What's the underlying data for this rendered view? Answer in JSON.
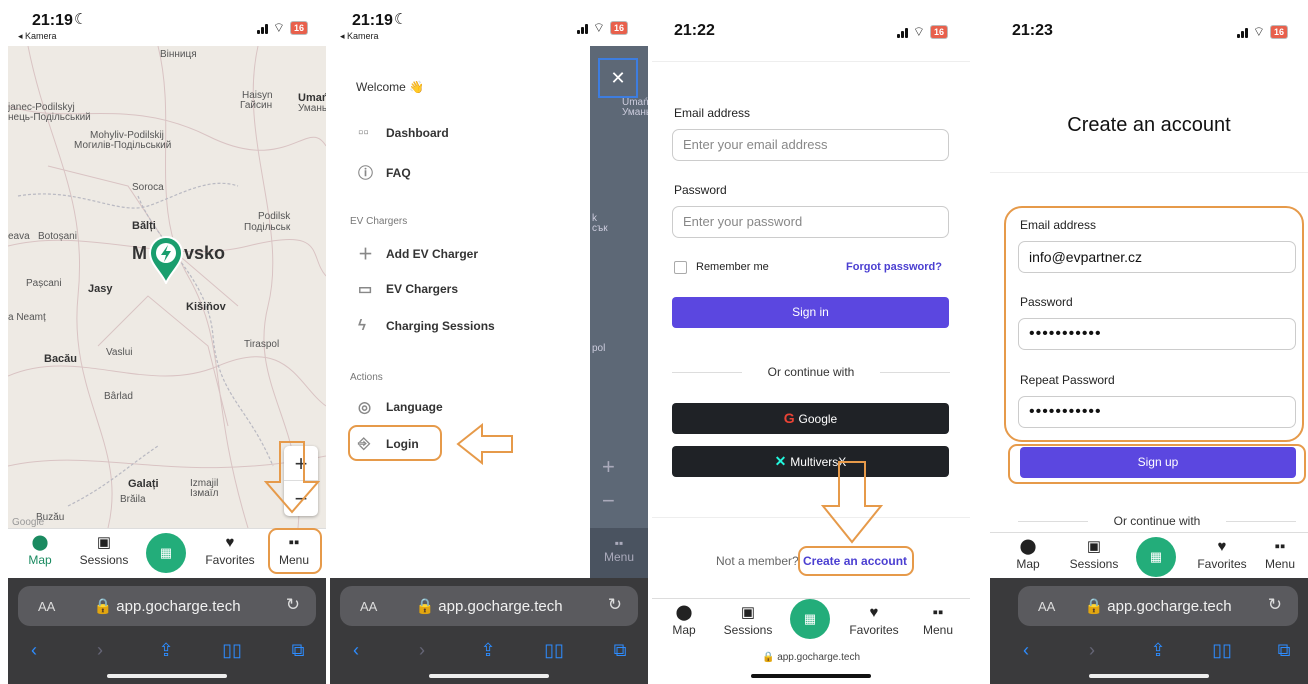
{
  "colors": {
    "accent": "#5b47e0",
    "brand_green": "#23ad7a",
    "annotation": "#e69a4a",
    "dark_button": "#1f2226"
  },
  "nav": {
    "map": "Map",
    "sessions": "Sessions",
    "favorites": "Favorites",
    "menu": "Menu"
  },
  "safari": {
    "aa": "AA",
    "url": "app.gocharge.tech"
  },
  "s1": {
    "time": "21:19",
    "back": "◂ Kamera",
    "battery": "16",
    "labels": [
      "Вінниця",
      "Haisyn",
      "Гайсин",
      "Umań",
      "Умань",
      "janec-Podilskyj",
      "нець-Подільський",
      "Mohyliv-Podilskij",
      "Могилів-Подільський",
      "Soroca",
      "Podilsk",
      "Подільськ",
      "Bălți",
      "eava",
      "Botoșani",
      "Pașcani",
      "Jasy",
      "Kišiňov",
      "a Neamț",
      "Tiraspol",
      "Vaslui",
      "Bacău",
      "Bârlad",
      "Galați",
      "Izmajil",
      "Ізмаїл",
      "Brăila",
      "Buzău",
      "Google"
    ],
    "marker_text": "M",
    "marker_text2": "vsko",
    "zoom_in": "+",
    "zoom_out": "−"
  },
  "s2": {
    "time": "21:19",
    "back": "◂ Kamera",
    "battery": "16",
    "welcome": "Welcome 👋",
    "items": [
      "Dashboard",
      "FAQ"
    ],
    "section_ev": "EV Chargers",
    "ev_items": [
      "Add EV Charger",
      "EV Chargers",
      "Charging Sessions"
    ],
    "section_actions": "Actions",
    "action_items": [
      "Language",
      "Login"
    ],
    "close": "✕",
    "menu_label": "Menu",
    "peek": [
      "Umań",
      "Умань",
      "k",
      "сък",
      "pol"
    ]
  },
  "s3": {
    "time": "21:22",
    "battery": "16",
    "email_label": "Email address",
    "email_placeholder": "Enter your email address",
    "password_label": "Password",
    "password_placeholder": "Enter your password",
    "remember": "Remember me",
    "forgot": "Forgot password?",
    "signin": "Sign in",
    "or": "Or continue with",
    "google": "Google",
    "multiversx": "MultiversX",
    "not_member": "Not a member?",
    "create": "Create an account",
    "url": "app.gocharge.tech"
  },
  "s4": {
    "time": "21:23",
    "battery": "16",
    "title": "Create an account",
    "email_label": "Email address",
    "email_value": "info@evpartner.cz",
    "password_label": "Password",
    "password_value": "•••••••••••",
    "repeat_label": "Repeat Password",
    "repeat_value": "•••••••••••",
    "signup": "Sign up",
    "or": "Or continue with"
  }
}
